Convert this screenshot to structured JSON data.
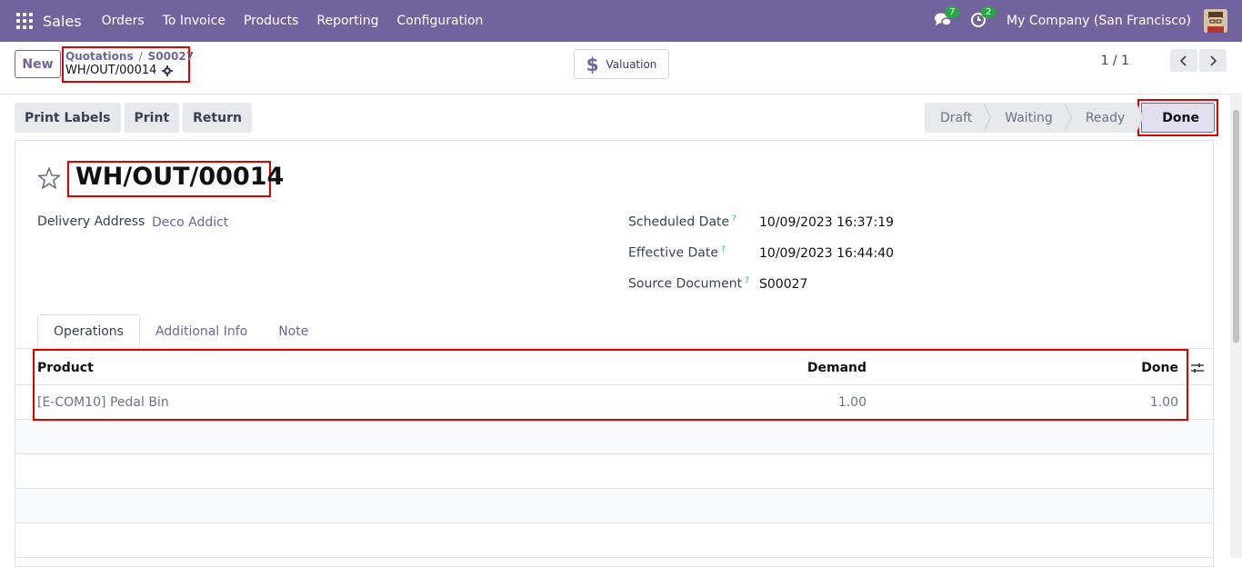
{
  "nav": {
    "app_name": "Sales",
    "menu": [
      "Orders",
      "To Invoice",
      "Products",
      "Reporting",
      "Configuration"
    ],
    "messages_count": "7",
    "activities_count": "2",
    "company": "My Company (San Francisco)",
    "accent_color": "#71639e"
  },
  "control": {
    "new_label": "New",
    "breadcrumb_parent": "Quotations",
    "breadcrumb_order": "S00027",
    "breadcrumb_current": "WH/OUT/00014",
    "valuation_label": "Valuation",
    "pager": "1 / 1"
  },
  "actions": {
    "print_labels": "Print Labels",
    "print": "Print",
    "return": "Return"
  },
  "statusbar": [
    "Draft",
    "Waiting",
    "Ready",
    "Done"
  ],
  "statusbar_current": "Done",
  "record": {
    "title": "WH/OUT/00014",
    "delivery_address_label": "Delivery Address",
    "delivery_address": "Deco Addict",
    "scheduled_date_label": "Scheduled Date",
    "scheduled_date": "10/09/2023 16:37:19",
    "effective_date_label": "Effective Date",
    "effective_date": "10/09/2023 16:44:40",
    "source_document_label": "Source Document",
    "source_document": "S00027",
    "help_mark": "?"
  },
  "tabs": [
    "Operations",
    "Additional Info",
    "Note"
  ],
  "table": {
    "headers": [
      "Product",
      "Demand",
      "Done"
    ],
    "rows": [
      {
        "product": "[E-COM10] Pedal Bin",
        "demand": "1.00",
        "done": "1.00"
      }
    ]
  }
}
